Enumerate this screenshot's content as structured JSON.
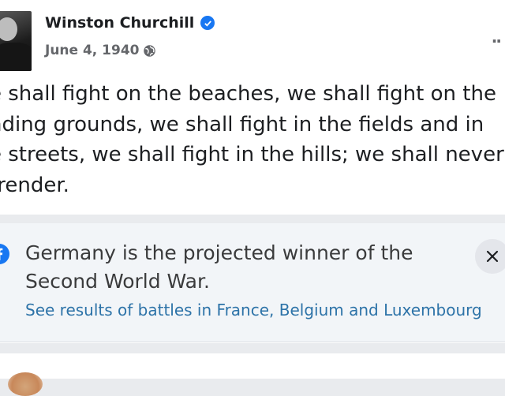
{
  "post": {
    "author": "Winston Churchill",
    "date": "June 4, 1940",
    "lines": [
      "e shall fight on the beaches, we shall fight on the",
      "nding grounds, we shall fight in the fields and in",
      "e streets, we shall fight in the hills; we shall never",
      "rrender."
    ],
    "icons": {
      "verified": "verified-badge-icon",
      "audience": "globe-icon",
      "menu": "more-options-icon"
    }
  },
  "notice": {
    "title_lines": [
      "Germany is the projected winner of the",
      "Second World War."
    ],
    "link": "See results of battles in France, Belgium and Luxembourg",
    "icons": {
      "source": "facebook-icon",
      "dismiss": "close-icon"
    }
  },
  "colors": {
    "brand_blue": "#1877f2",
    "link_blue": "#2d73a8",
    "text": "#1c1e21",
    "secondary_text": "#65676b",
    "notice_bg": "#f2f5f8"
  }
}
